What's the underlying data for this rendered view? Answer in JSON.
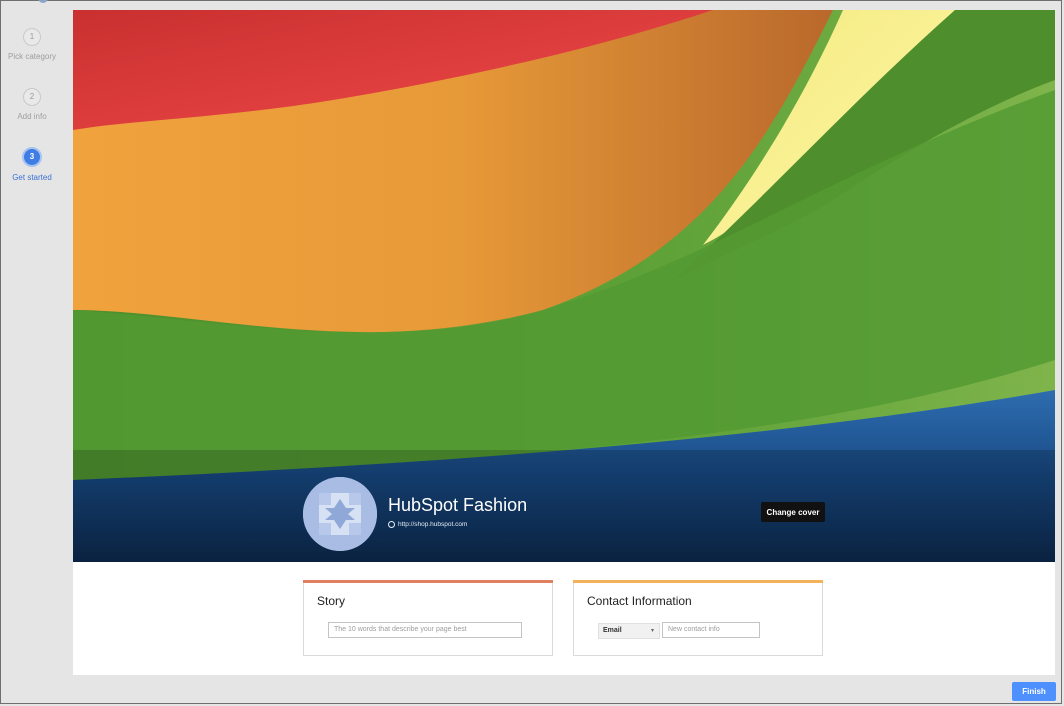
{
  "stepper": {
    "steps": [
      {
        "number": "1",
        "label": "Pick category",
        "state": "done"
      },
      {
        "number": "2",
        "label": "Add info",
        "state": "done"
      },
      {
        "number": "3",
        "label": "Get started",
        "state": "active"
      }
    ]
  },
  "cover": {
    "page_name": "HubSpot Fashion",
    "url": "http://shop.hubspot.com",
    "change_cover_label": "Change cover"
  },
  "story": {
    "title": "Story",
    "placeholder": "The 10 words that describe your page best"
  },
  "contact": {
    "title": "Contact Information",
    "type_selected": "Email",
    "placeholder": "New contact info"
  },
  "footer": {
    "finish_label": "Finish"
  },
  "colors": {
    "accent": "#4d90fe",
    "active_step": "#3f7ce3",
    "story_bar": "#e17f63",
    "contact_bar": "#f2b25d"
  },
  "icons": [
    "globe-icon",
    "dropdown-caret-icon",
    "profile-placeholder-icon"
  ]
}
